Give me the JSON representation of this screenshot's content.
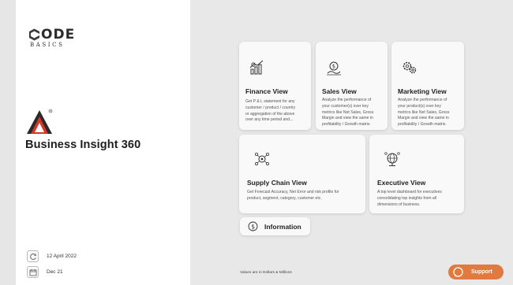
{
  "brand": {
    "top": "ODE",
    "bottom": "BASICS"
  },
  "app": {
    "title": "Business Insight 360"
  },
  "meta": {
    "refresh_date": "12 April 2022",
    "data_month": "Dec 21"
  },
  "cards": [
    {
      "id": "finance",
      "title": "Finance View",
      "icon": "finance-chart-icon",
      "desc": [
        "Get P & L statement for any",
        "customer / product / country",
        "or aggregation of the above",
        "over any time period and..."
      ]
    },
    {
      "id": "sales",
      "title": "Sales View",
      "icon": "sales-money-icon",
      "desc": [
        "Analyze the performance of",
        "your customer(s) over key",
        "metrics like Net Sales, Gross",
        "Margin and view the same in",
        "profitability / Growth matrix."
      ]
    },
    {
      "id": "marketing",
      "title": "Marketing View",
      "icon": "marketing-gear-icon",
      "desc": [
        "Analyze the performance of",
        "your product(s) over key",
        "metrics like Net Sales, Gross",
        "Margin and view the same in",
        "profitability / Growth matrix."
      ]
    },
    {
      "id": "supply",
      "title": "Supply Chain View",
      "icon": "supply-chain-icon",
      "desc": [
        "Get Forecast Accuracy, Net Error and risk profile for",
        "product, segment, category, customer etc."
      ]
    },
    {
      "id": "executive",
      "title": "Executive View",
      "icon": "executive-globe-icon",
      "desc": [
        "A top level dashboard for executives",
        "consolidating top insights from all",
        "dimensions of business."
      ]
    }
  ],
  "info": {
    "label": "Information"
  },
  "footnote": "Values are in Dollars & Millions",
  "support": {
    "label": "Support"
  },
  "colors": {
    "accent": "#e07a3f",
    "logo_red": "#d9362b",
    "logo_dark": "#2a2a2a"
  }
}
